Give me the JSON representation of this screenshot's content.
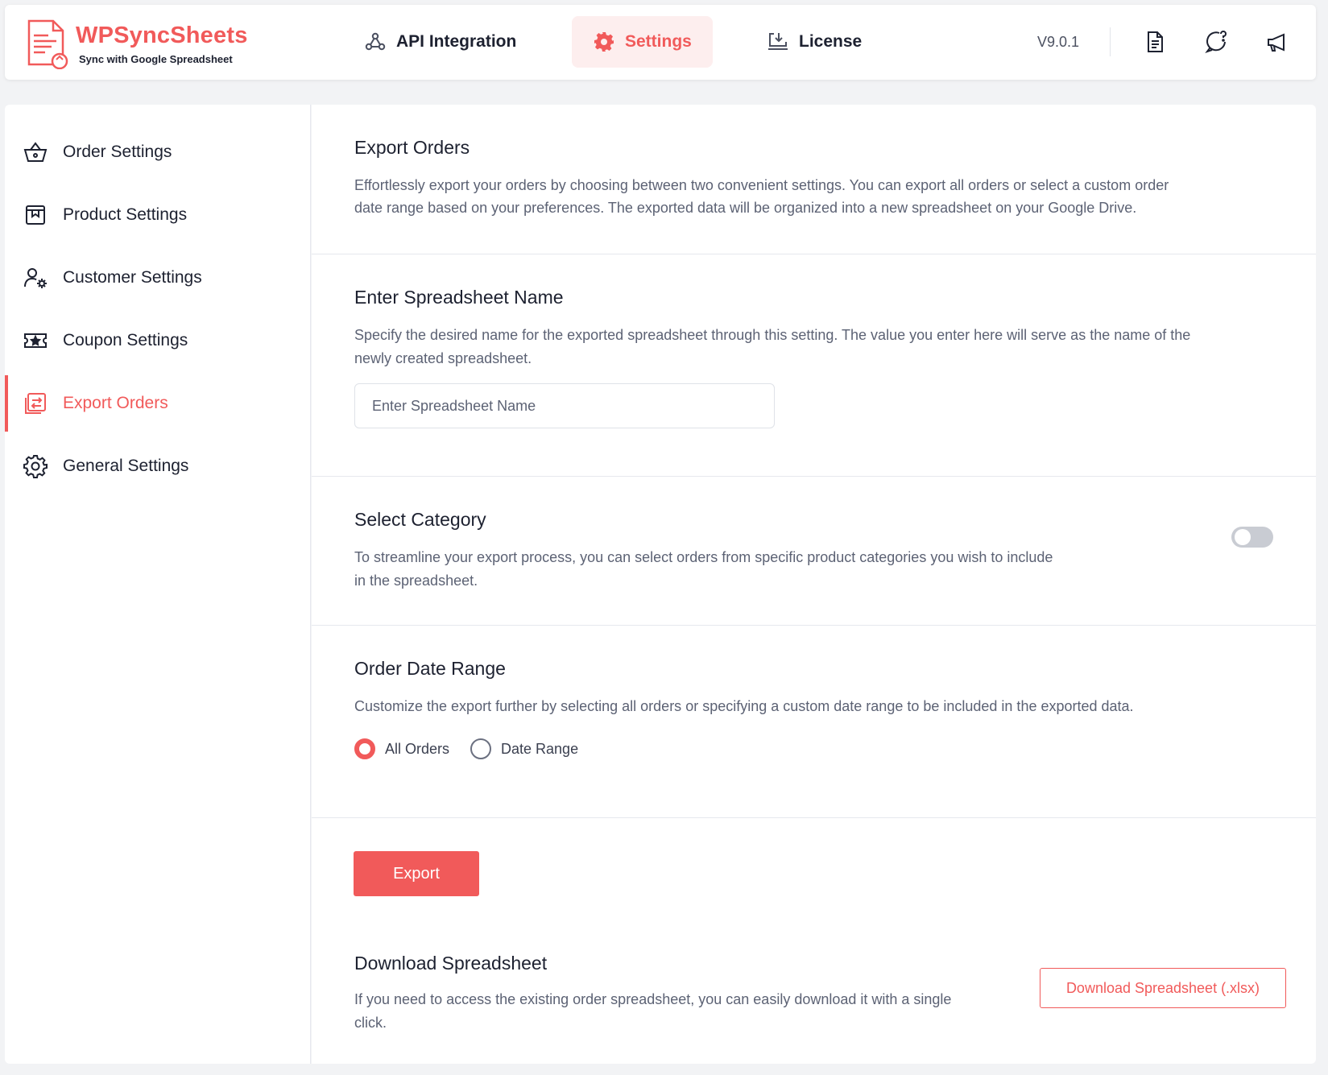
{
  "brand": {
    "name": "WPSyncSheets",
    "tagline": "Sync with Google Spreadsheet",
    "accent_color": "#f15a5a"
  },
  "nav": {
    "tabs": [
      {
        "label": "API Integration",
        "icon": "webhook-icon",
        "active": false
      },
      {
        "label": "Settings",
        "icon": "gear-icon",
        "active": true
      },
      {
        "label": "License",
        "icon": "download-monitor-icon",
        "active": false
      }
    ],
    "version": "V9.0.1",
    "icons": [
      "document-icon",
      "chat-help-icon",
      "megaphone-icon"
    ]
  },
  "sidebar": {
    "items": [
      {
        "label": "Order Settings",
        "icon": "basket-icon",
        "active": false
      },
      {
        "label": "Product Settings",
        "icon": "box-icon",
        "active": false
      },
      {
        "label": "Customer Settings",
        "icon": "user-gear-icon",
        "active": false
      },
      {
        "label": "Coupon Settings",
        "icon": "ticket-star-icon",
        "active": false
      },
      {
        "label": "Export Orders",
        "icon": "export-icon",
        "active": true
      },
      {
        "label": "General Settings",
        "icon": "gear-icon",
        "active": false
      }
    ]
  },
  "export_orders": {
    "title": "Export Orders",
    "description_line1": "Effortlessly export your orders by choosing between two convenient settings. You can export all orders or select a custom order",
    "description_line2": "date range based on your preferences. The exported data will be organized into a new spreadsheet on your Google Drive."
  },
  "spreadsheet_name": {
    "title": "Enter Spreadsheet Name",
    "description_line1": "Specify the desired name for the exported spreadsheet through this setting. The value you enter here will serve as the name of the",
    "description_line2": "newly created spreadsheet.",
    "input_value": "",
    "input_placeholder": "Enter Spreadsheet Name"
  },
  "select_category": {
    "title": "Select Category",
    "description_line1": "To streamline your export process, you can select orders from specific product categories you wish to include",
    "description_line2": "in the spreadsheet.",
    "toggle_on": false
  },
  "date_range": {
    "title": "Order Date Range",
    "description": "Customize the export further by selecting all orders or specifying a custom date range to be included in the exported data.",
    "options": [
      {
        "label": "All Orders",
        "checked": true
      },
      {
        "label": "Date Range",
        "checked": false
      }
    ]
  },
  "export_button_label": "Export",
  "download": {
    "title": "Download Spreadsheet",
    "description_line1": "If you need to access the existing order spreadsheet, you can easily download it with a single",
    "description_line2": "click.",
    "button_label": "Download Spreadsheet (.xlsx)"
  }
}
